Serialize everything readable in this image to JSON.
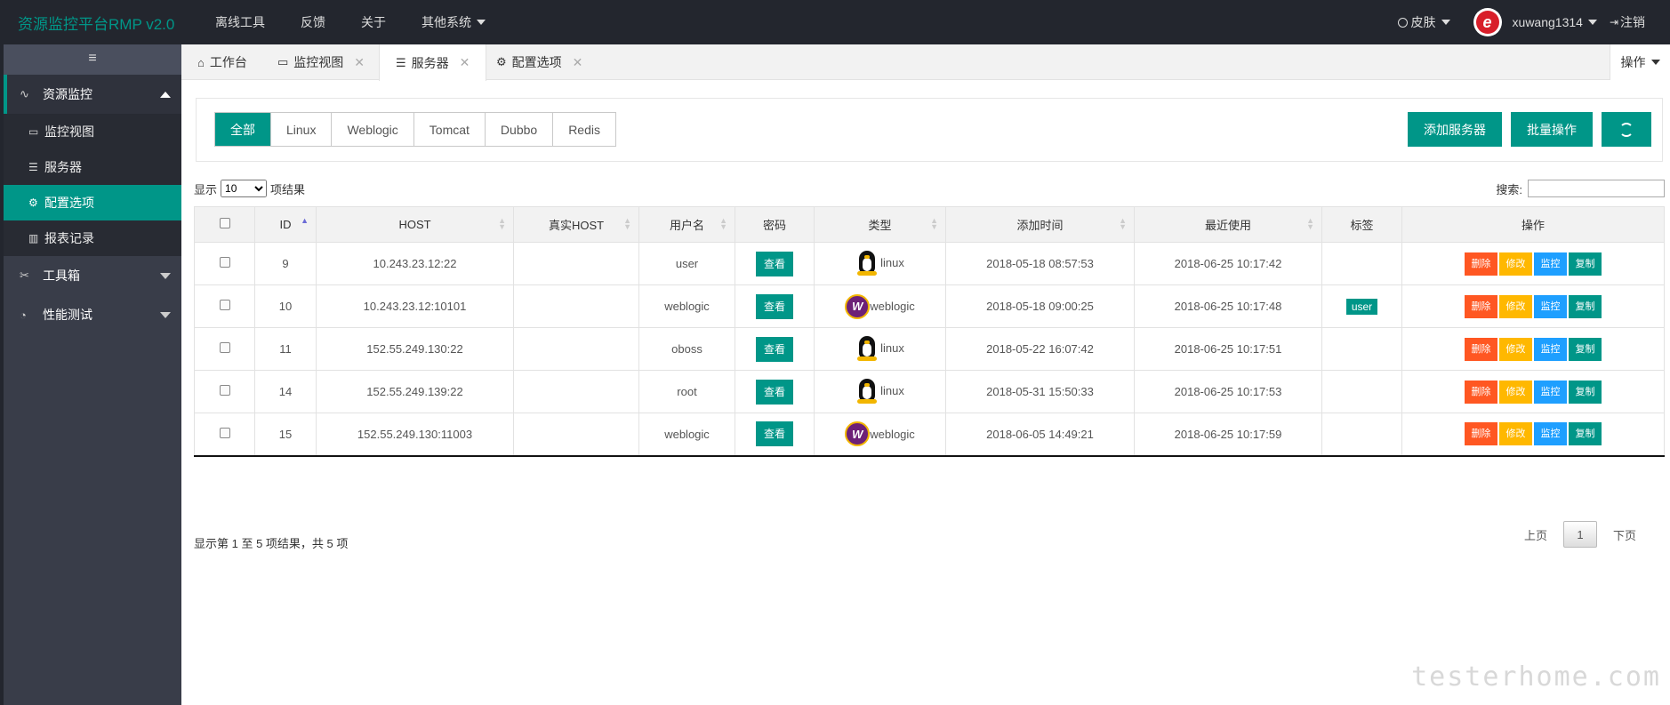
{
  "app": {
    "title": "资源监控平台RMP v2.0"
  },
  "topnav": {
    "items": [
      "离线工具",
      "反馈",
      "关于"
    ],
    "dropdown": "其他系统"
  },
  "topright": {
    "skin": "皮肤",
    "username": "xuwang1314",
    "logout": "注销"
  },
  "sidebar": {
    "toggle": "≡",
    "groups": [
      {
        "label": "资源监控",
        "expanded": true,
        "items": [
          {
            "label": "监控视图"
          },
          {
            "label": "服务器"
          },
          {
            "label": "配置选项",
            "active": true
          },
          {
            "label": "报表记录"
          }
        ]
      },
      {
        "label": "工具箱"
      },
      {
        "label": "性能测试"
      }
    ]
  },
  "tabs": {
    "items": [
      {
        "label": "工作台"
      },
      {
        "label": "监控视图"
      },
      {
        "label": "服务器",
        "active": true
      },
      {
        "label": "配置选项"
      }
    ],
    "ops": "操作"
  },
  "filters": {
    "items": [
      "全部",
      "Linux",
      "Weblogic",
      "Tomcat",
      "Dubbo",
      "Redis"
    ],
    "active": "全部"
  },
  "actions": {
    "add": "添加服务器",
    "batch": "批量操作"
  },
  "datatable": {
    "show": "显示",
    "length": "10",
    "results": "项结果",
    "search": "搜索:"
  },
  "table": {
    "columns": [
      "ID",
      "HOST",
      "真实HOST",
      "用户名",
      "密码",
      "类型",
      "添加时间",
      "最近使用",
      "标签",
      "操作"
    ],
    "view_label": "查看",
    "action_labels": {
      "delete": "删除",
      "edit": "修改",
      "monitor": "监控",
      "copy": "复制"
    },
    "rows": [
      {
        "id": "9",
        "host": "10.243.23.12:22",
        "real_host": "",
        "username": "user",
        "type": "linux",
        "added": "2018-05-18 08:57:53",
        "last_used": "2018-06-25 10:17:42",
        "tag": ""
      },
      {
        "id": "10",
        "host": "10.243.23.12:10101",
        "real_host": "",
        "username": "weblogic",
        "type": "weblogic",
        "added": "2018-05-18 09:00:25",
        "last_used": "2018-06-25 10:17:48",
        "tag": "user"
      },
      {
        "id": "11",
        "host": "152.55.249.130:22",
        "real_host": "",
        "username": "oboss",
        "type": "linux",
        "added": "2018-05-22 16:07:42",
        "last_used": "2018-06-25 10:17:51",
        "tag": ""
      },
      {
        "id": "14",
        "host": "152.55.249.139:22",
        "real_host": "",
        "username": "root",
        "type": "linux",
        "added": "2018-05-31 15:50:33",
        "last_used": "2018-06-25 10:17:53",
        "tag": ""
      },
      {
        "id": "15",
        "host": "152.55.249.130:11003",
        "real_host": "",
        "username": "weblogic",
        "type": "weblogic",
        "added": "2018-06-05 14:49:21",
        "last_used": "2018-06-25 10:17:59",
        "tag": ""
      }
    ]
  },
  "footer": {
    "info": "显示第 1 至 5 项结果，共 5 项",
    "prev": "上页",
    "page": "1",
    "next": "下页"
  },
  "watermark": "testerhome.com",
  "colors": {
    "accent": "#009688",
    "topbar": "#23262e",
    "sidebar": "#393d49",
    "delete": "#ff5722",
    "edit": "#ffb800",
    "monitor": "#1e9fff"
  }
}
